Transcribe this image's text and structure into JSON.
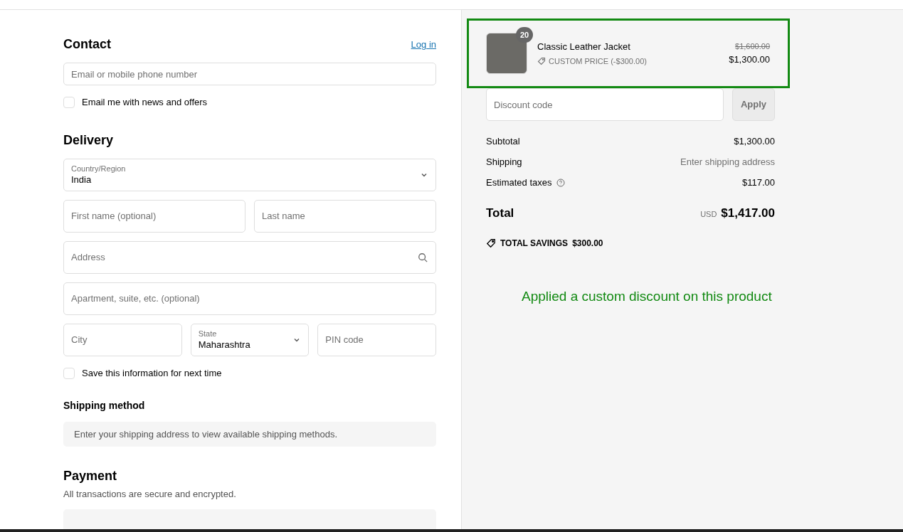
{
  "contact": {
    "title": "Contact",
    "login_link": "Log in",
    "email": {
      "placeholder": "Email or mobile phone number"
    },
    "newsletter": {
      "label": "Email me with news and offers",
      "checked": false
    }
  },
  "delivery": {
    "title": "Delivery",
    "rows": [
      [
        {
          "kind": "select",
          "label": "Country/Region",
          "value": "India"
        }
      ],
      [
        {
          "kind": "text",
          "placeholder": "First name (optional)"
        },
        {
          "kind": "text",
          "placeholder": "Last name"
        }
      ],
      [
        {
          "kind": "search",
          "placeholder": "Address"
        }
      ],
      [
        {
          "kind": "text",
          "placeholder": "Apartment, suite, etc. (optional)"
        }
      ],
      [
        {
          "kind": "text",
          "placeholder": "City"
        },
        {
          "kind": "select",
          "label": "State",
          "value": "Maharashtra"
        },
        {
          "kind": "text",
          "placeholder": "PIN code"
        }
      ]
    ],
    "save": {
      "label": "Save this information for next time",
      "checked": false
    }
  },
  "shipping_method": {
    "title": "Shipping method",
    "message": "Enter your shipping address to view available shipping methods."
  },
  "payment": {
    "title": "Payment",
    "subtitle": "All transactions are secure and encrypted."
  },
  "cart_item": {
    "quantity": "20",
    "name": "Classic Leather Jacket",
    "discount": "CUSTOM PRICE (-$300.00)",
    "original_price": "$1,600.00",
    "price": "$1,300.00"
  },
  "discount": {
    "placeholder": "Discount code",
    "button": "Apply"
  },
  "summary": [
    {
      "label": "Subtotal",
      "value": "$1,300.00",
      "muted": false,
      "info": false
    },
    {
      "label": "Shipping",
      "value": "Enter shipping address",
      "muted": true,
      "info": false
    },
    {
      "label": "Estimated taxes",
      "value": "$117.00",
      "muted": false,
      "info": true
    }
  ],
  "total": {
    "label": "Total",
    "currency": "USD",
    "value": "$1,417.00"
  },
  "savings": {
    "label": "TOTAL SAVINGS",
    "value": "$300.00"
  },
  "annotation": "Applied a custom discount on this product"
}
